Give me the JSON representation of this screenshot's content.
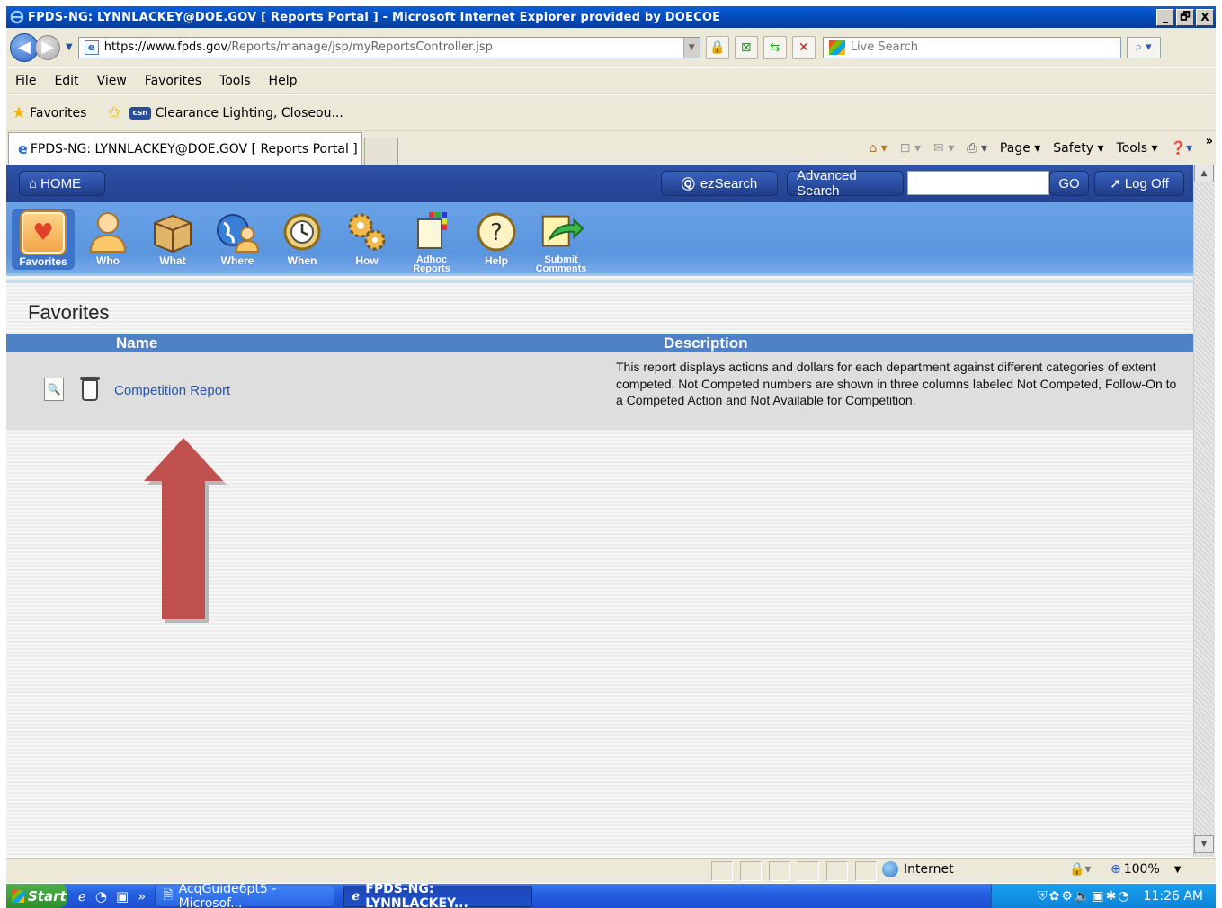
{
  "window": {
    "title": "FPDS-NG: LYNNLACKEY@DOE.GOV [ Reports Portal ] - Microsoft Internet Explorer provided by DOECOE",
    "min": "_",
    "max": "🗗",
    "close": "X"
  },
  "address": {
    "url_prefix": "https://www.",
    "url_domain": "fpds.gov",
    "url_path": "/Reports/manage/jsp/myReportsController.jsp",
    "search_placeholder": "Live Search"
  },
  "menu": [
    "File",
    "Edit",
    "View",
    "Favorites",
    "Tools",
    "Help"
  ],
  "favorites_bar": {
    "favorites_label": "Favorites",
    "link_badge": "csn",
    "link_label": "Clearance Lighting, Closeou..."
  },
  "tab": {
    "label": "FPDS-NG: LYNNLACKEY@DOE.GOV [ Reports Portal ]"
  },
  "command_bar": {
    "page": "Page ▾",
    "safety": "Safety ▾",
    "tools": "Tools ▾",
    "overflow": "»"
  },
  "site_nav": {
    "home": "HOME",
    "ezsearch": "ezSearch",
    "advanced": "Advanced Search",
    "go": "GO",
    "logoff": "Log Off"
  },
  "toolbar": [
    {
      "label": "Favorites",
      "icon": "favorites-folder-icon"
    },
    {
      "label": "Who",
      "icon": "person-icon"
    },
    {
      "label": "What",
      "icon": "box-icon"
    },
    {
      "label": "Where",
      "icon": "globe-person-icon"
    },
    {
      "label": "When",
      "icon": "clock-icon"
    },
    {
      "label": "How",
      "icon": "gears-icon"
    },
    {
      "label": "Adhoc Reports",
      "icon": "adhoc-reports-icon"
    },
    {
      "label": "Help",
      "icon": "help-icon"
    },
    {
      "label": "Submit Comments",
      "icon": "submit-comments-icon"
    }
  ],
  "favorites": {
    "heading": "Favorites",
    "columns": {
      "name": "Name",
      "description": "Description"
    },
    "rows": [
      {
        "name": "Competition Report",
        "description": "This report displays actions and dollars for each department against different categories of extent competed. Not Competed numbers are shown in three columns labeled Not Competed, Follow-On to a Competed Action and Not Available for Competition."
      }
    ]
  },
  "status_bar": {
    "zone": "Internet",
    "zoom": "100%"
  },
  "taskbar": {
    "start": "Start",
    "task1": "AcqGuide6pt5 - Microsof...",
    "task2": "FPDS-NG: LYNNLACKEY...",
    "clock": "11:26 AM"
  },
  "colors": {
    "site_nav_blue": "#23428f",
    "toolbar_blue": "#5a95df",
    "header_blue": "#4f81c7",
    "link_blue": "#2457a7",
    "arrow_red": "#c0504d"
  }
}
